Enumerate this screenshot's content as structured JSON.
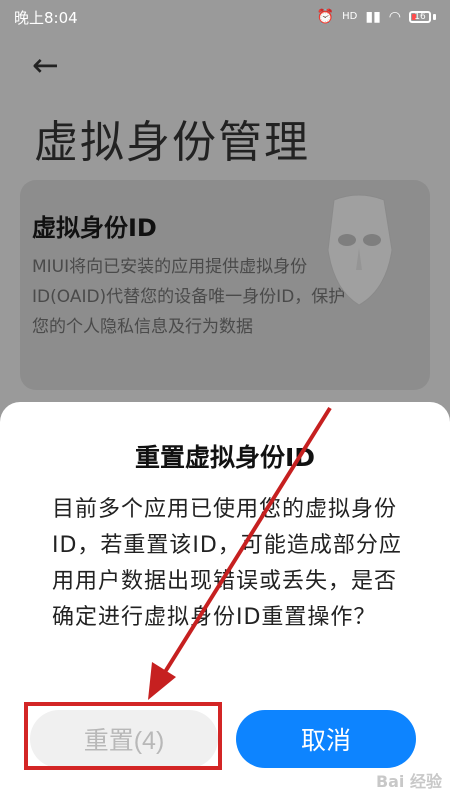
{
  "status_bar": {
    "time": "晚上8:04",
    "network": "HD",
    "battery": "16"
  },
  "background_page": {
    "title": "虚拟身份管理",
    "card": {
      "title": "虚拟身份ID",
      "description": "MIUI将向已安装的应用提供虚拟身份ID(OAID)代替您的设备唯一身份ID，保护您的个人隐私信息及行为数据"
    }
  },
  "dialog": {
    "title": "重置虚拟身份ID",
    "message": "目前多个应用已使用您的虚拟身份ID，若重置该ID，可能造成部分应用用户数据出现错误或丢失，是否确定进行虚拟身份ID重置操作？",
    "reset_button": "重置(4)",
    "cancel_button": "取消"
  },
  "watermark": "Bai 经验",
  "colors": {
    "accent": "#0d84ff",
    "annotation": "#d32525"
  }
}
